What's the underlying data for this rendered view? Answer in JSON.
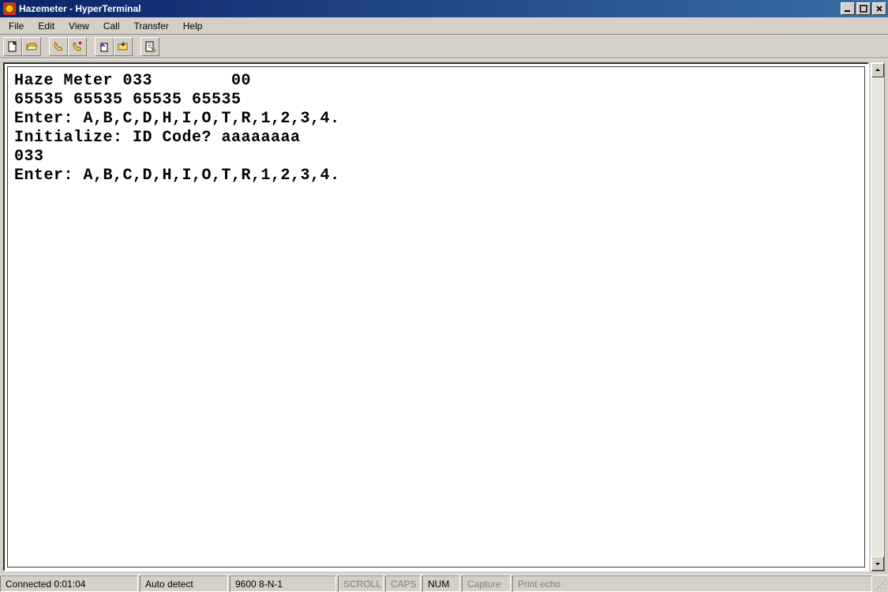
{
  "titlebar": {
    "title": "Hazemeter - HyperTerminal"
  },
  "menubar": {
    "items": [
      "File",
      "Edit",
      "View",
      "Call",
      "Transfer",
      "Help"
    ]
  },
  "toolbar": {
    "groups": [
      [
        "new-file-icon",
        "open-file-icon"
      ],
      [
        "call-icon",
        "hangup-icon"
      ],
      [
        "send-icon",
        "receive-icon"
      ],
      [
        "properties-icon"
      ]
    ]
  },
  "terminal": {
    "lines": [
      "Haze Meter 033        00",
      "65535 65535 65535 65535",
      "Enter: A,B,C,D,H,I,O,T,R,1,2,3,4.",
      "Initialize: ID Code? aaaaaaaa",
      "033",
      "Enter: A,B,C,D,H,I,O,T,R,1,2,3,4."
    ]
  },
  "statusbar": {
    "connected": "Connected 0:01:04",
    "detect": "Auto detect",
    "port": "9600 8-N-1",
    "scroll": "SCROLL",
    "caps": "CAPS",
    "num": "NUM",
    "capture": "Capture",
    "printecho": "Print echo"
  }
}
